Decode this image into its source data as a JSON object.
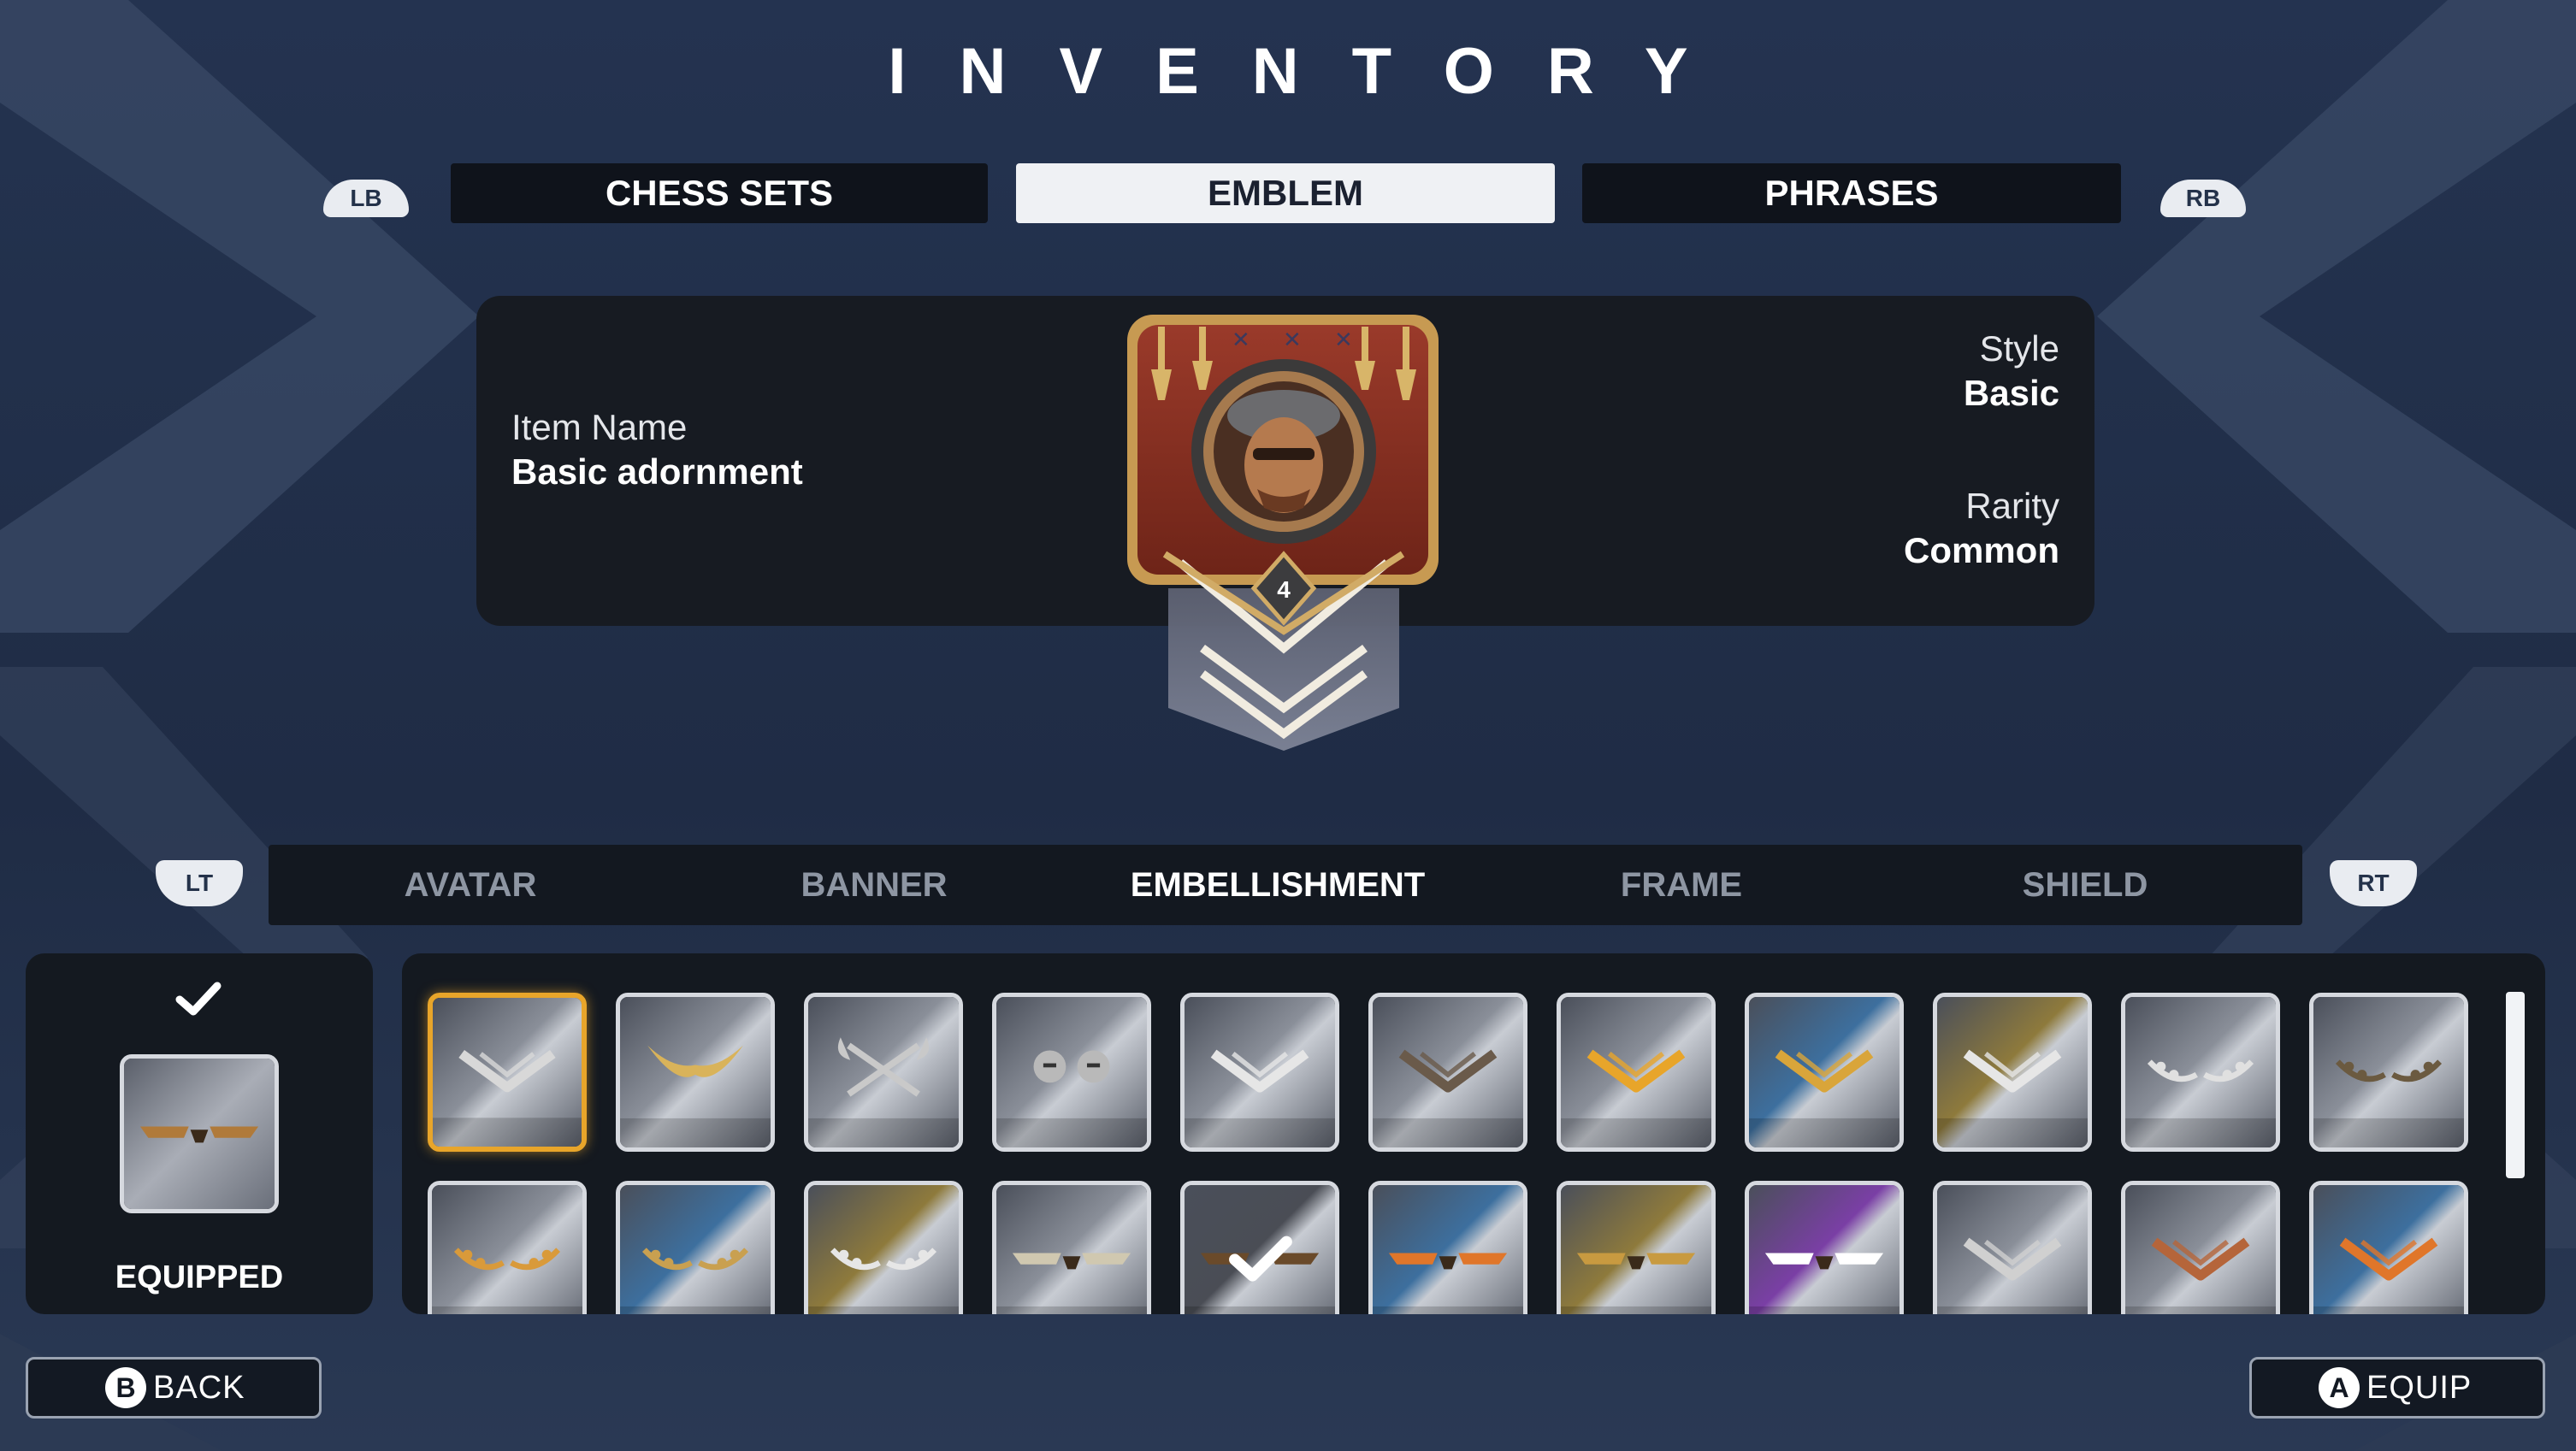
{
  "header": {
    "title": "INVENTORY"
  },
  "bumpers": {
    "left": "LB",
    "right": "RB"
  },
  "triggers": {
    "left": "LT",
    "right": "RT"
  },
  "main_tabs": [
    {
      "label": "CHESS SETS",
      "active": false
    },
    {
      "label": "EMBLEM",
      "active": true
    },
    {
      "label": "PHRASES",
      "active": false
    }
  ],
  "item": {
    "name_label": "Item Name",
    "name": "Basic adornment",
    "style_label": "Style",
    "style": "Basic",
    "rarity_label": "Rarity",
    "rarity": "Common",
    "emblem_level": "4"
  },
  "sub_tabs": [
    {
      "label": "AVATAR",
      "active": false
    },
    {
      "label": "BANNER",
      "active": false
    },
    {
      "label": "EMBELLISHMENT",
      "active": true
    },
    {
      "label": "FRAME",
      "active": false
    },
    {
      "label": "SHIELD",
      "active": false
    }
  ],
  "equipped": {
    "label": "EQUIPPED"
  },
  "grid": {
    "rows": [
      [
        "chevron-v-icon",
        "golden-horns-icon",
        "crossed-axes-icon",
        "warrior-helmets-icon",
        "silver-chevron-icon",
        "dark-chevron-icon",
        "gold-chevron-icon",
        "blue-gold-chevron-icon",
        "winged-chevron-icon",
        "silver-laurel-icon",
        "bronze-laurel-icon"
      ],
      [
        "orange-laurel-icon",
        "blue-laurel-icon",
        "gold-white-laurel-icon",
        "silver-wings-icon",
        "equipped-checkmark-icon",
        "blue-orange-wings-icon",
        "gold-wings-icon",
        "purple-wings-icon",
        "silver-v-icon",
        "bronze-v-icon",
        "blue-orange-v-icon"
      ]
    ],
    "tints": [
      [
        "#8a8f99",
        "#8a8f99",
        "#8a8f99",
        "#8a8f99",
        "#8a8f99",
        "#8a8f99",
        "#8a8f99",
        "#3d6f9e",
        "#8e7a3c",
        "#8a8f99",
        "#8a8f99"
      ],
      [
        "#8a8f99",
        "#3d6f9e",
        "#8e7a3c",
        "#8a8f99",
        "#4a4d55",
        "#3d6f9e",
        "#8e7a3c",
        "#7a3fa5",
        "#8a8f99",
        "#8a8f99",
        "#3d6f9e"
      ]
    ],
    "emblem_colors": [
      [
        "#d8d8d8",
        "#d9b35a",
        "#c9c9c9",
        "#b9b9b9",
        "#e6e6e6",
        "#6a5a4a",
        "#e8a52a",
        "#d9a53a",
        "#e6e6e6",
        "#e0e0e0",
        "#6b5a40"
      ],
      [
        "#d99a3a",
        "#c9a050",
        "#e6e6e6",
        "#d0c8b0",
        "#ffffff",
        "#e0762a",
        "#c89a40",
        "#ffffff",
        "#d0d0d0",
        "#b5653a",
        "#e0762a"
      ]
    ]
  },
  "buttons": {
    "back": {
      "key": "B",
      "label": "BACK"
    },
    "equip": {
      "key": "A",
      "label": "EQUIP"
    }
  },
  "colors": {
    "background": "#22304a",
    "panel": "#171b22",
    "selected_border": "#e8a52a",
    "active_tab": "#eff1f4"
  }
}
